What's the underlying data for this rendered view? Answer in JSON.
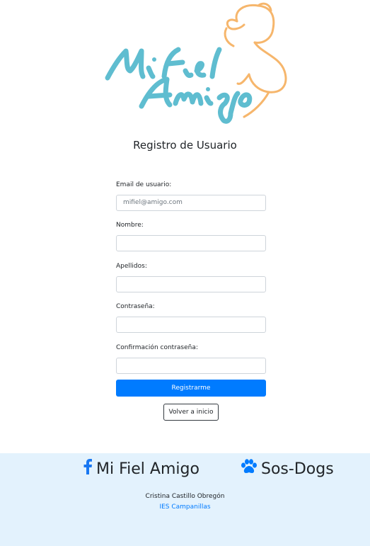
{
  "logo": {
    "brand_text": "Mi Fiel Amigo",
    "colors": {
      "script": "#5fbdd0",
      "dog_outline": "#f6b66c"
    }
  },
  "page": {
    "title": "Registro de Usuario"
  },
  "form": {
    "email": {
      "label": "Email de usuario:",
      "value": "",
      "placeholder": "mifiel@amigo.com"
    },
    "nombre": {
      "label": "Nombre:",
      "value": ""
    },
    "apellidos": {
      "label": "Apellidos:",
      "value": ""
    },
    "password": {
      "label": "Contraseña:",
      "value": ""
    },
    "password_confirm": {
      "label": "Confirmación contraseña:",
      "value": ""
    },
    "register_label": "Registrarme",
    "back_label": "Volver a inicio"
  },
  "footer": {
    "links": [
      {
        "label": "Mi Fiel Amigo",
        "icon": "facebook-icon"
      },
      {
        "label": "Sos-Dogs",
        "icon": "paw-icon"
      }
    ],
    "author": "Cristina Castillo Obregón",
    "school": "IES Campanillas",
    "colors": {
      "background": "#e3f2fd",
      "fb": "#1877f2",
      "paw": "#007bff"
    }
  },
  "colors": {
    "primary": "#007bff"
  }
}
